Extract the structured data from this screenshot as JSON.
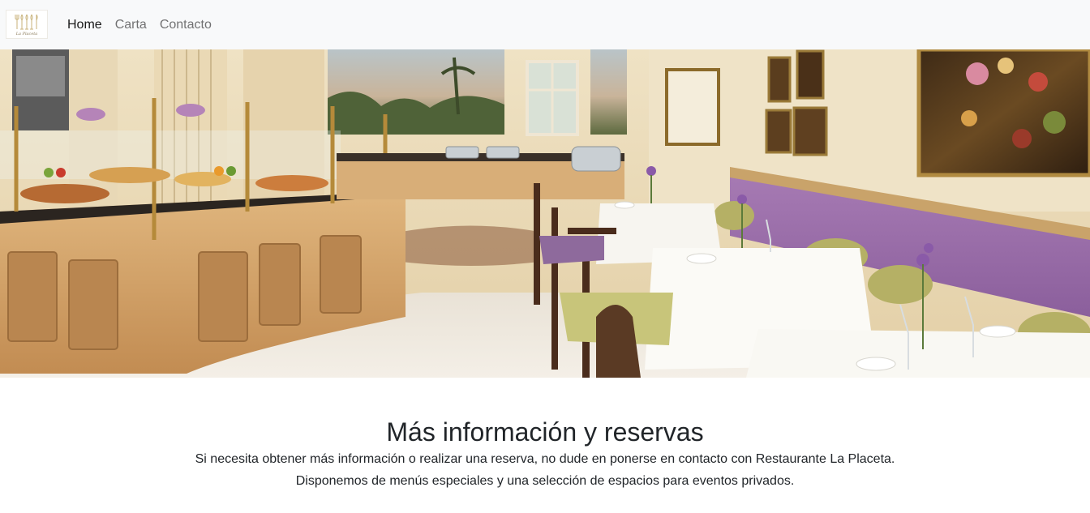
{
  "brand": {
    "logo_text": "La Placeta",
    "logo_icon": "cutlery-glasses-icon"
  },
  "nav": {
    "items": [
      {
        "label": "Home",
        "active": true
      },
      {
        "label": "Carta",
        "active": false
      },
      {
        "label": "Contacto",
        "active": false
      }
    ]
  },
  "hero": {
    "image": "restaurant-dining-room-photo"
  },
  "info": {
    "title": "Más información y reservas",
    "line1": "Si necesita obtener más información o realizar una reserva, no dude en ponerse en contacto con Restaurante La Placeta.",
    "line2": "Disponemos de menús especiales y una selección de espacios para eventos privados."
  },
  "colors": {
    "navbar_bg": "#f8f9fa",
    "nav_active": "#1a1a1a",
    "nav_inactive": "#737373",
    "text": "#212529"
  }
}
